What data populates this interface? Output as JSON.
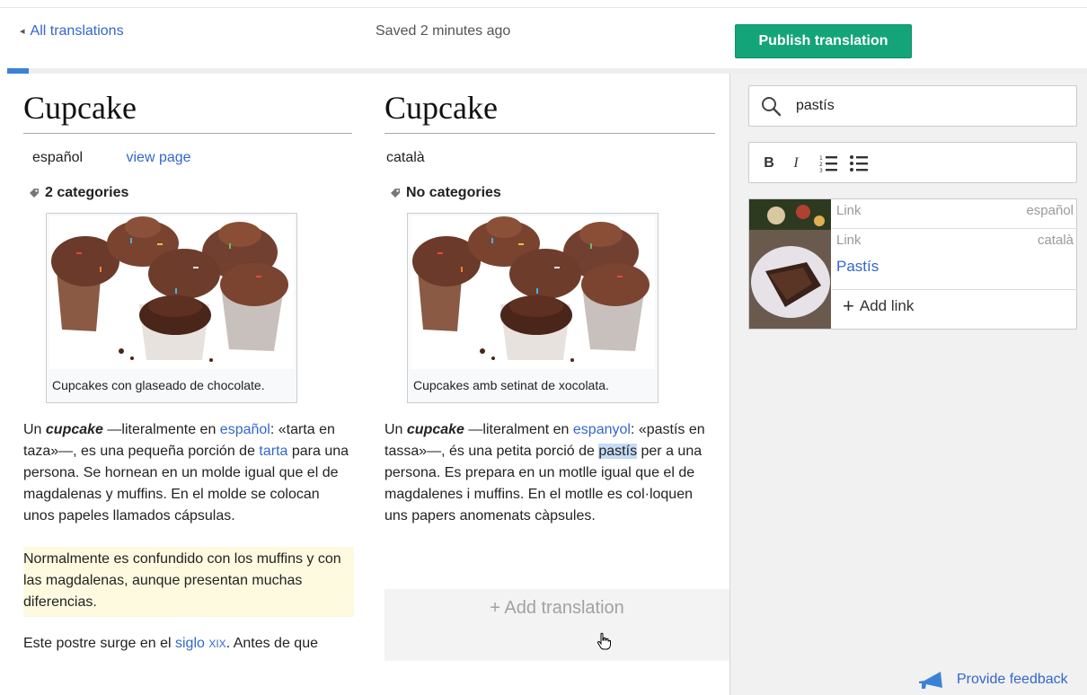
{
  "header": {
    "back_label": "All translations",
    "saved_status": "Saved 2 minutes ago",
    "publish_label": "Publish translation",
    "progress_fraction": 0.02
  },
  "source": {
    "title": "Cupcake",
    "language": "español",
    "view_page": "view page",
    "categories": "2 categories",
    "caption": "Cupcakes con glaseado de chocolate.",
    "p1": {
      "t1": "Un ",
      "bold": "cupcake",
      "t2": " —literalmente en ",
      "link1": "español",
      "t3": ": «tarta en taza»—, es una pequeña porción de ",
      "link2": "tarta",
      "t4": " para una persona. Se hornean en un molde igual que el de magdalenas y muffins. En el molde se colocan unos papeles llamados cápsulas."
    },
    "p2": "Normalmente es confundido con los muffins y con las magdalenas, aunque presentan muchas diferencias.",
    "p3": {
      "t1": "Este postre surge en el ",
      "link1": "siglo",
      "t2": " ",
      "smallcaps": "XIX",
      "t3": ". Antes de que"
    }
  },
  "target": {
    "title": "Cupcake",
    "language": "català",
    "categories": "No categories",
    "caption": "Cupcakes amb setinat de xocolata.",
    "p1": {
      "t1": "Un ",
      "bold": "cupcake",
      "t2": " —literalment en ",
      "link1": "espanyol",
      "t3": ": «pastís en tassa»—, és una petita porció de ",
      "highlight": "pastís",
      "t4": " per a una persona. Es prepara en un motlle igual que el de magdalenes i muffins. En el motlle es col·loquen uns papers anomenats càpsules."
    },
    "add_translation": "+ Add translation"
  },
  "sidebar": {
    "search_value": "pastís",
    "format": {
      "bold": "B",
      "italic": "I"
    },
    "link_card": {
      "source_label": "Link",
      "source_lang": "español",
      "target_label": "Link",
      "target_lang": "català",
      "target_link": "Pastís",
      "add_link": "Add link"
    },
    "feedback": "Provide feedback"
  },
  "colors": {
    "accent_green": "#14a47a",
    "link_blue": "#3366cc",
    "highlight": "#c6dcf5",
    "yellow_bg": "#fdfae0"
  }
}
